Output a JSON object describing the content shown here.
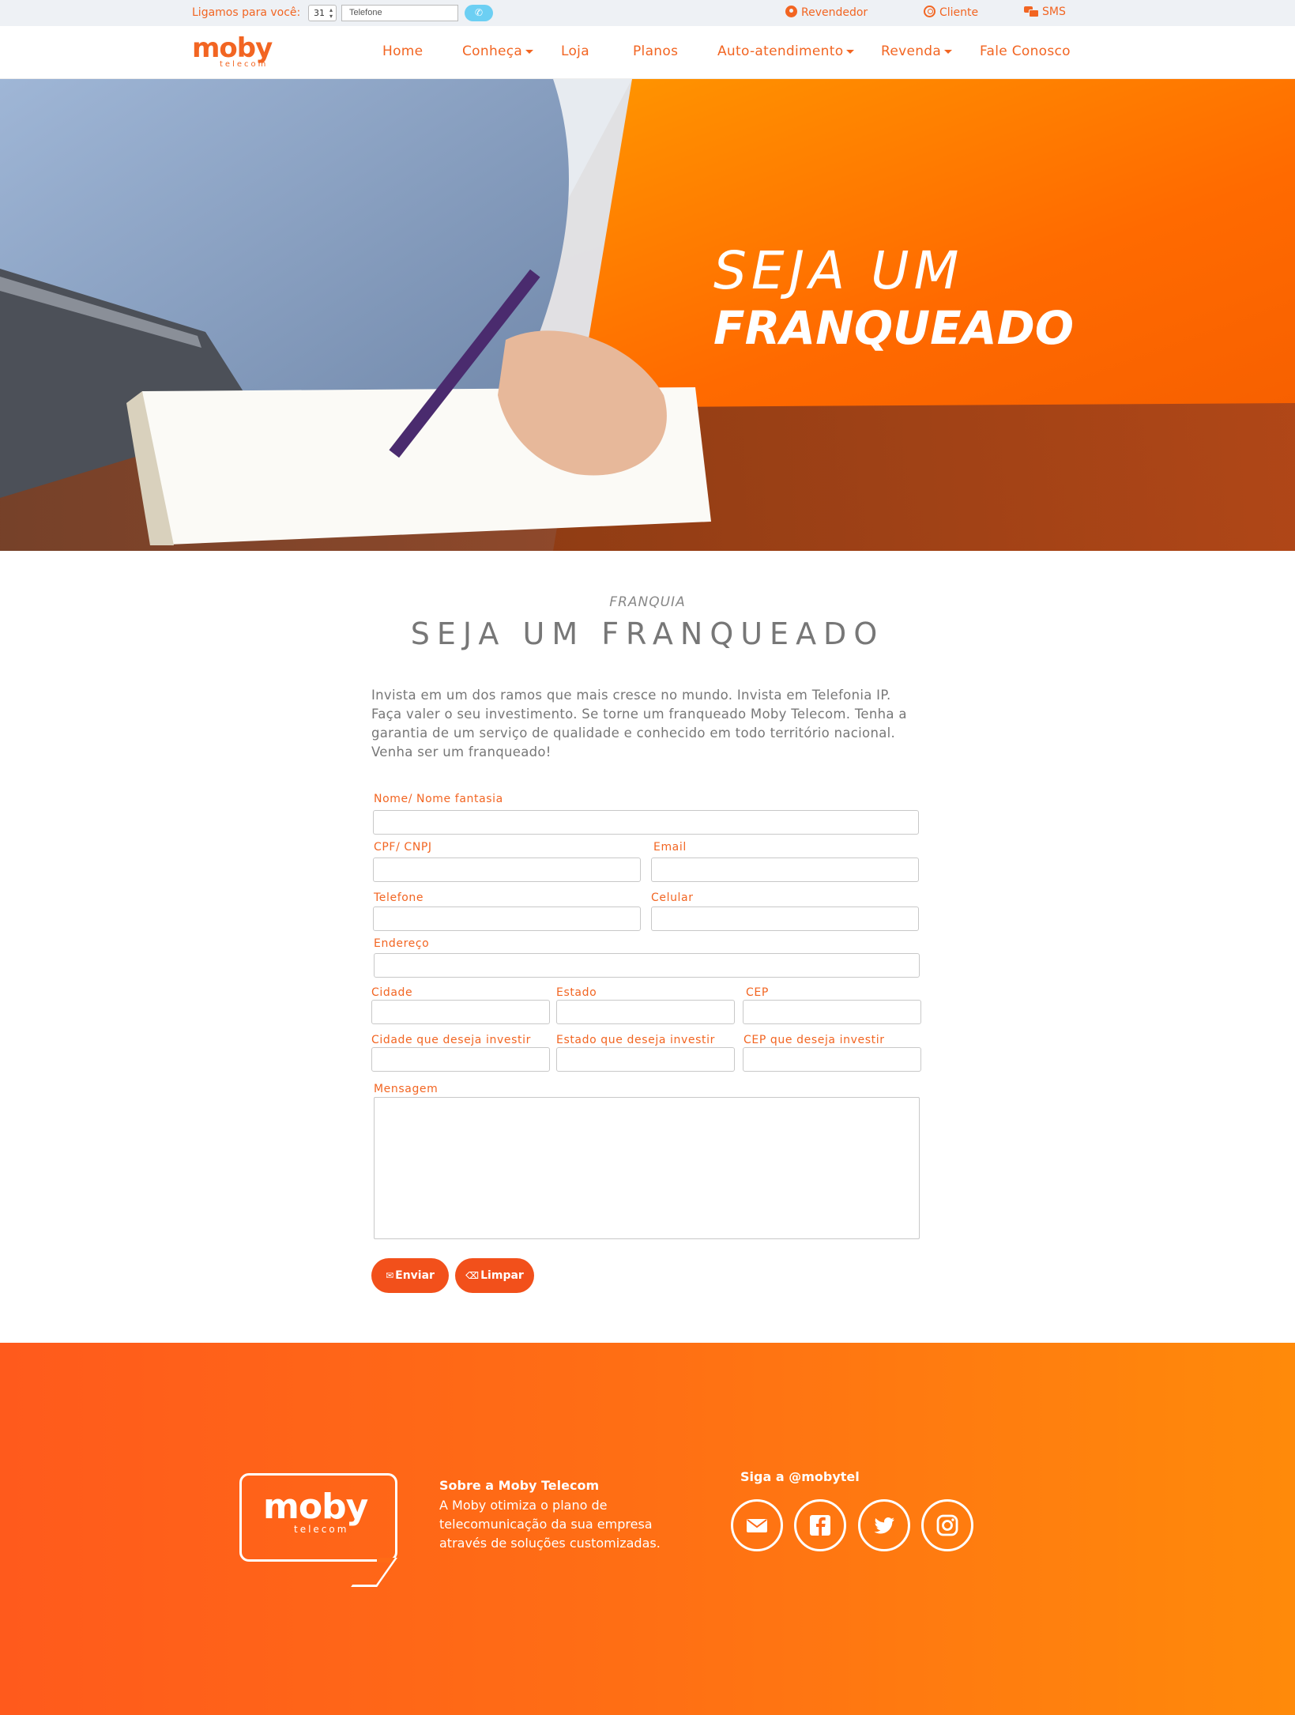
{
  "topbar": {
    "call_label": "Ligamos para você:",
    "ddd_value": "31",
    "phone_placeholder": "Telefone",
    "links": [
      {
        "label": "Revendedor",
        "icon": "user-circle-icon"
      },
      {
        "label": "Cliente",
        "icon": "user-outline-icon"
      },
      {
        "label": "SMS",
        "icon": "chat-icon"
      }
    ]
  },
  "brand": {
    "name": "moby",
    "tagline": "telecom",
    "accent": "#f26522",
    "button_color": "#f2501b"
  },
  "nav": {
    "items": [
      {
        "label": "Home"
      },
      {
        "label": "Conheça"
      },
      {
        "label": "Loja"
      },
      {
        "label": "Planos"
      },
      {
        "label": "Auto-atendimento"
      },
      {
        "label": "Revenda"
      },
      {
        "label": "Fale Conosco"
      }
    ]
  },
  "hero": {
    "line1": "SEJA UM",
    "line2": "FRANQUEADO"
  },
  "content": {
    "eyebrow": "FRANQUIA",
    "title": "SEJA UM FRANQUEADO",
    "intro": "Invista em um dos ramos que mais cresce no mundo. Invista em Telefonia IP. Faça valer o seu investimento. Se torne um franqueado Moby Telecom. Tenha a garantia de um serviço de qualidade e conhecido em todo território nacional. Venha ser um franqueado!"
  },
  "form": {
    "name": "Nome/ Nome fantasia",
    "cpf": "CPF/ CNPJ",
    "email": "Email",
    "phone": "Telefone",
    "mobile": "Celular",
    "address": "Endereço",
    "city": "Cidade",
    "state": "Estado",
    "cep": "CEP",
    "invest_city": "Cidade que deseja investir",
    "invest_state": "Estado que deseja investir",
    "invest_cep": "CEP que deseja investir",
    "message": "Mensagem",
    "submit": "Enviar",
    "clear": "Limpar"
  },
  "footer": {
    "about_title": "Sobre a Moby Telecom",
    "about_text": "A Moby otimiza o plano de telecomunicação da sua empresa através de soluções customizadas.",
    "follow": "Siga a @mobytel",
    "social": [
      "mail-icon",
      "facebook-icon",
      "twitter-icon",
      "instagram-icon"
    ]
  }
}
